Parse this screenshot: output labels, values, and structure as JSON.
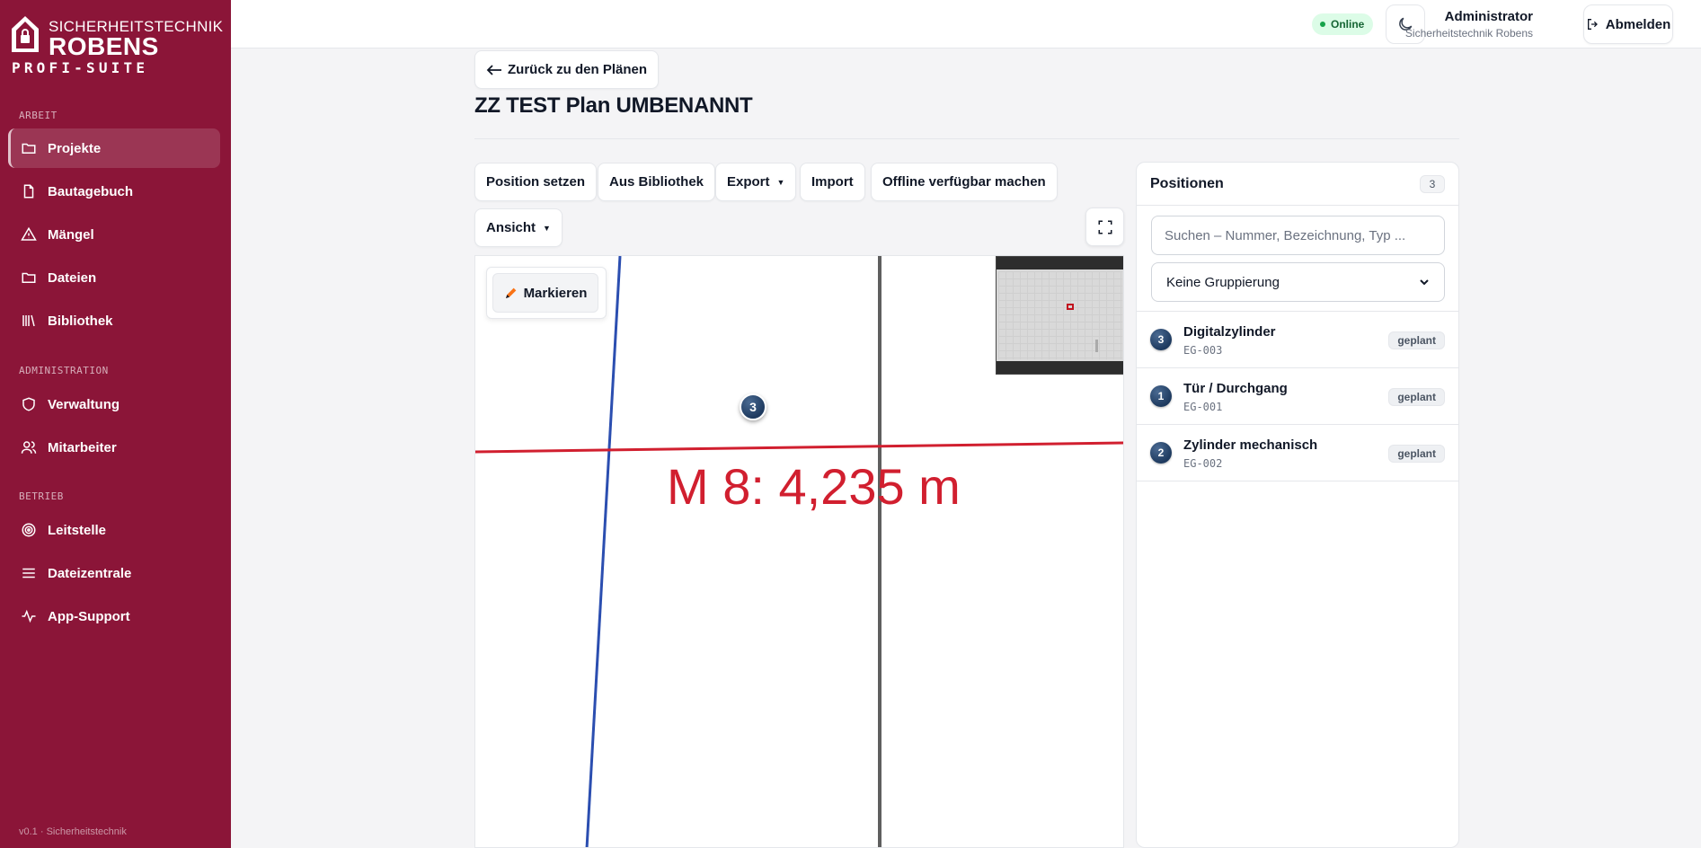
{
  "brand": {
    "line1": "SICHERHEITSTECHNIK",
    "line2": "ROBENS",
    "line3": "PROFI-SUITE"
  },
  "sidebar": {
    "sections": [
      {
        "label": "ARBEIT"
      },
      {
        "label": "ADMINISTRATION"
      },
      {
        "label": "BETRIEB"
      }
    ],
    "items": [
      {
        "label": "Projekte",
        "icon": "folder-icon",
        "active": true
      },
      {
        "label": "Bautagebuch",
        "icon": "file-icon"
      },
      {
        "label": "Mängel",
        "icon": "warning-icon"
      },
      {
        "label": "Dateien",
        "icon": "folder-icon"
      },
      {
        "label": "Bibliothek",
        "icon": "library-icon"
      },
      {
        "label": "Verwaltung",
        "icon": "shield-icon"
      },
      {
        "label": "Mitarbeiter",
        "icon": "users-icon"
      },
      {
        "label": "Leitstelle",
        "icon": "control-center-icon"
      },
      {
        "label": "Dateizentrale",
        "icon": "menu-lines-icon"
      },
      {
        "label": "App-Support",
        "icon": "activity-icon"
      }
    ],
    "version": "v0.1 · Sicherheitstechnik"
  },
  "topbar": {
    "status": "Online",
    "user_name": "Administrator",
    "user_org": "Sicherheitstechnik Robens",
    "logout_label": "Abmelden"
  },
  "main": {
    "back_label": "Zurück zu den Plänen",
    "title": "ZZ TEST Plan UMBENANNT",
    "toolbar": {
      "position_setzen": "Position setzen",
      "aus_bibliothek": "Aus Bibliothek",
      "export": "Export",
      "import": "Import",
      "offline": "Offline verfügbar machen",
      "ansicht": "Ansicht"
    },
    "canvas": {
      "mark_label": "Markieren",
      "measurement_text": "M 8: 4,235 m",
      "marker_number": "3"
    }
  },
  "positions": {
    "title": "Positionen",
    "count": "3",
    "search_placeholder": "Suchen – Nummer, Bezeichnung, Typ ...",
    "grouping_selected": "Keine Gruppierung",
    "items": [
      {
        "number": "3",
        "name": "Digitalzylinder",
        "code": "EG-003",
        "status": "geplant"
      },
      {
        "number": "1",
        "name": "Tür / Durchgang",
        "code": "EG-001",
        "status": "geplant"
      },
      {
        "number": "2",
        "name": "Zylinder mechanisch",
        "code": "EG-002",
        "status": "geplant"
      }
    ]
  },
  "colors": {
    "sidebar": "#8b1538",
    "accent_red": "#d11f2f",
    "line_blue": "#2b4eb0",
    "marker": "#1e3a5f",
    "online": "#16a34a"
  }
}
